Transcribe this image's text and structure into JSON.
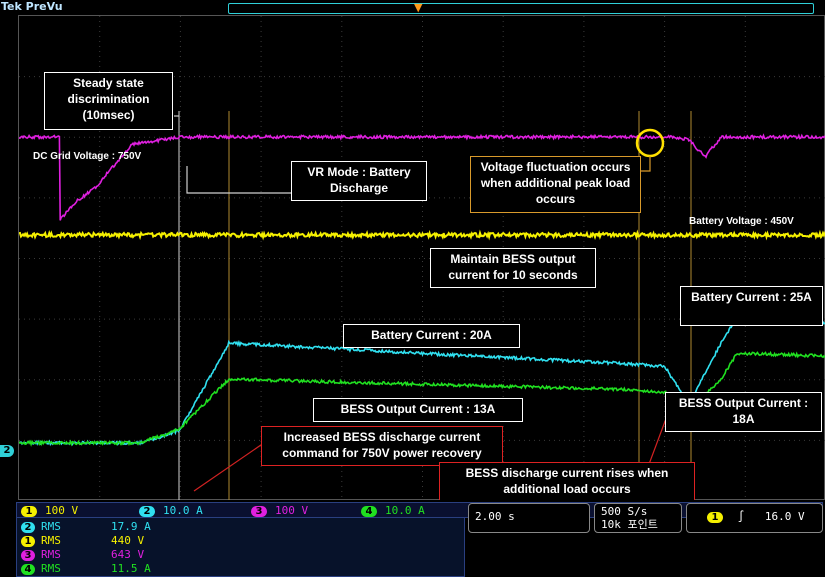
{
  "header": {
    "brand": "Tek",
    "mode": "PreVu"
  },
  "colors": {
    "ch1": "#f5f000",
    "ch2": "#30e0f0",
    "ch3": "#e020e0",
    "ch4": "#20e020",
    "annotation_orange": "#d99a2b",
    "annotation_red": "#d22222"
  },
  "icons": {
    "trigger_position": "trigger-arrow-icon",
    "ch2_level": "ch2-ground-marker-icon"
  },
  "annotations": {
    "steady_state": "Steady state discrimination (10msec)",
    "dc_grid_voltage": "DC Grid Voltage : 750V",
    "vr_mode": "VR Mode : Battery Discharge",
    "voltage_fluct": "Voltage fluctuation occurs when additional peak load occurs",
    "battery_voltage": "Battery Voltage : 450V",
    "maintain": "Maintain BESS output current for 10 seconds",
    "battery_current_20": "Battery Current : 20A",
    "battery_current_25": "Battery Current : 25A",
    "bess_output_13": "BESS Output Current : 13A",
    "bess_output_18": "BESS Output Current : 18A",
    "increased": "Increased BESS discharge current command for 750V power recovery",
    "rises": "BESS discharge current rises when additional load occurs"
  },
  "channel_bar": [
    {
      "num": "1",
      "scale": "100 V"
    },
    {
      "num": "2",
      "scale": "10.0 A"
    },
    {
      "num": "3",
      "scale": "100 V"
    },
    {
      "num": "4",
      "scale": "10.0 A"
    }
  ],
  "measurements": [
    {
      "num": "2",
      "label": "RMS",
      "value": "17.9 A"
    },
    {
      "num": "1",
      "label": "RMS",
      "value": "440 V"
    },
    {
      "num": "3",
      "label": "RMS",
      "value": "643 V"
    },
    {
      "num": "4",
      "label": "RMS",
      "value": "11.5 A"
    }
  ],
  "timebase": "2.00 s",
  "sample_rate": "500 S/s",
  "record_length": "10k 포인트",
  "trigger": {
    "channel": "1",
    "slope": "rising-edge-icon",
    "level": "16.0 V"
  },
  "chart_data": {
    "type": "line",
    "grid": true,
    "divisions": {
      "x": 10,
      "y": 8
    },
    "series": [
      {
        "name": "DC Grid Voltage",
        "channel": "3",
        "color": "#e020e0",
        "x": [
          0,
          0.5,
          0.51,
          0.7,
          0.95,
          1.4,
          2.0,
          4.0,
          6.0,
          8.1,
          8.3,
          8.5,
          8.7,
          10.0
        ],
        "y": [
          750,
          750,
          585,
          620,
          650,
          735,
          750,
          750,
          750,
          750,
          745,
          710,
          750,
          750
        ]
      },
      {
        "name": "Battery Voltage",
        "channel": "1",
        "color": "#f5f000",
        "x": [
          0,
          10.0
        ],
        "y": [
          450,
          450
        ]
      },
      {
        "name": "Battery Current",
        "channel": "2",
        "color": "#30e0f0",
        "x": [
          0,
          1.5,
          1.65,
          1.8,
          2.0,
          2.6,
          5.0,
          7.5,
          8.0,
          8.3,
          8.7,
          8.9,
          10.0
        ],
        "y": [
          0.6,
          0.6,
          1.2,
          2.0,
          3.2,
          20,
          18,
          16,
          15.5,
          8,
          20,
          25,
          24
        ]
      },
      {
        "name": "BESS Output Current",
        "channel": "4",
        "color": "#20e020",
        "x": [
          0,
          1.5,
          1.65,
          1.8,
          2.0,
          2.6,
          5.0,
          7.5,
          8.0,
          8.3,
          8.7,
          8.9,
          10.0
        ],
        "y": [
          0.6,
          0.6,
          1.5,
          2.0,
          3.5,
          13,
          12,
          11,
          10.5,
          7,
          13,
          18,
          17.5
        ]
      }
    ]
  }
}
